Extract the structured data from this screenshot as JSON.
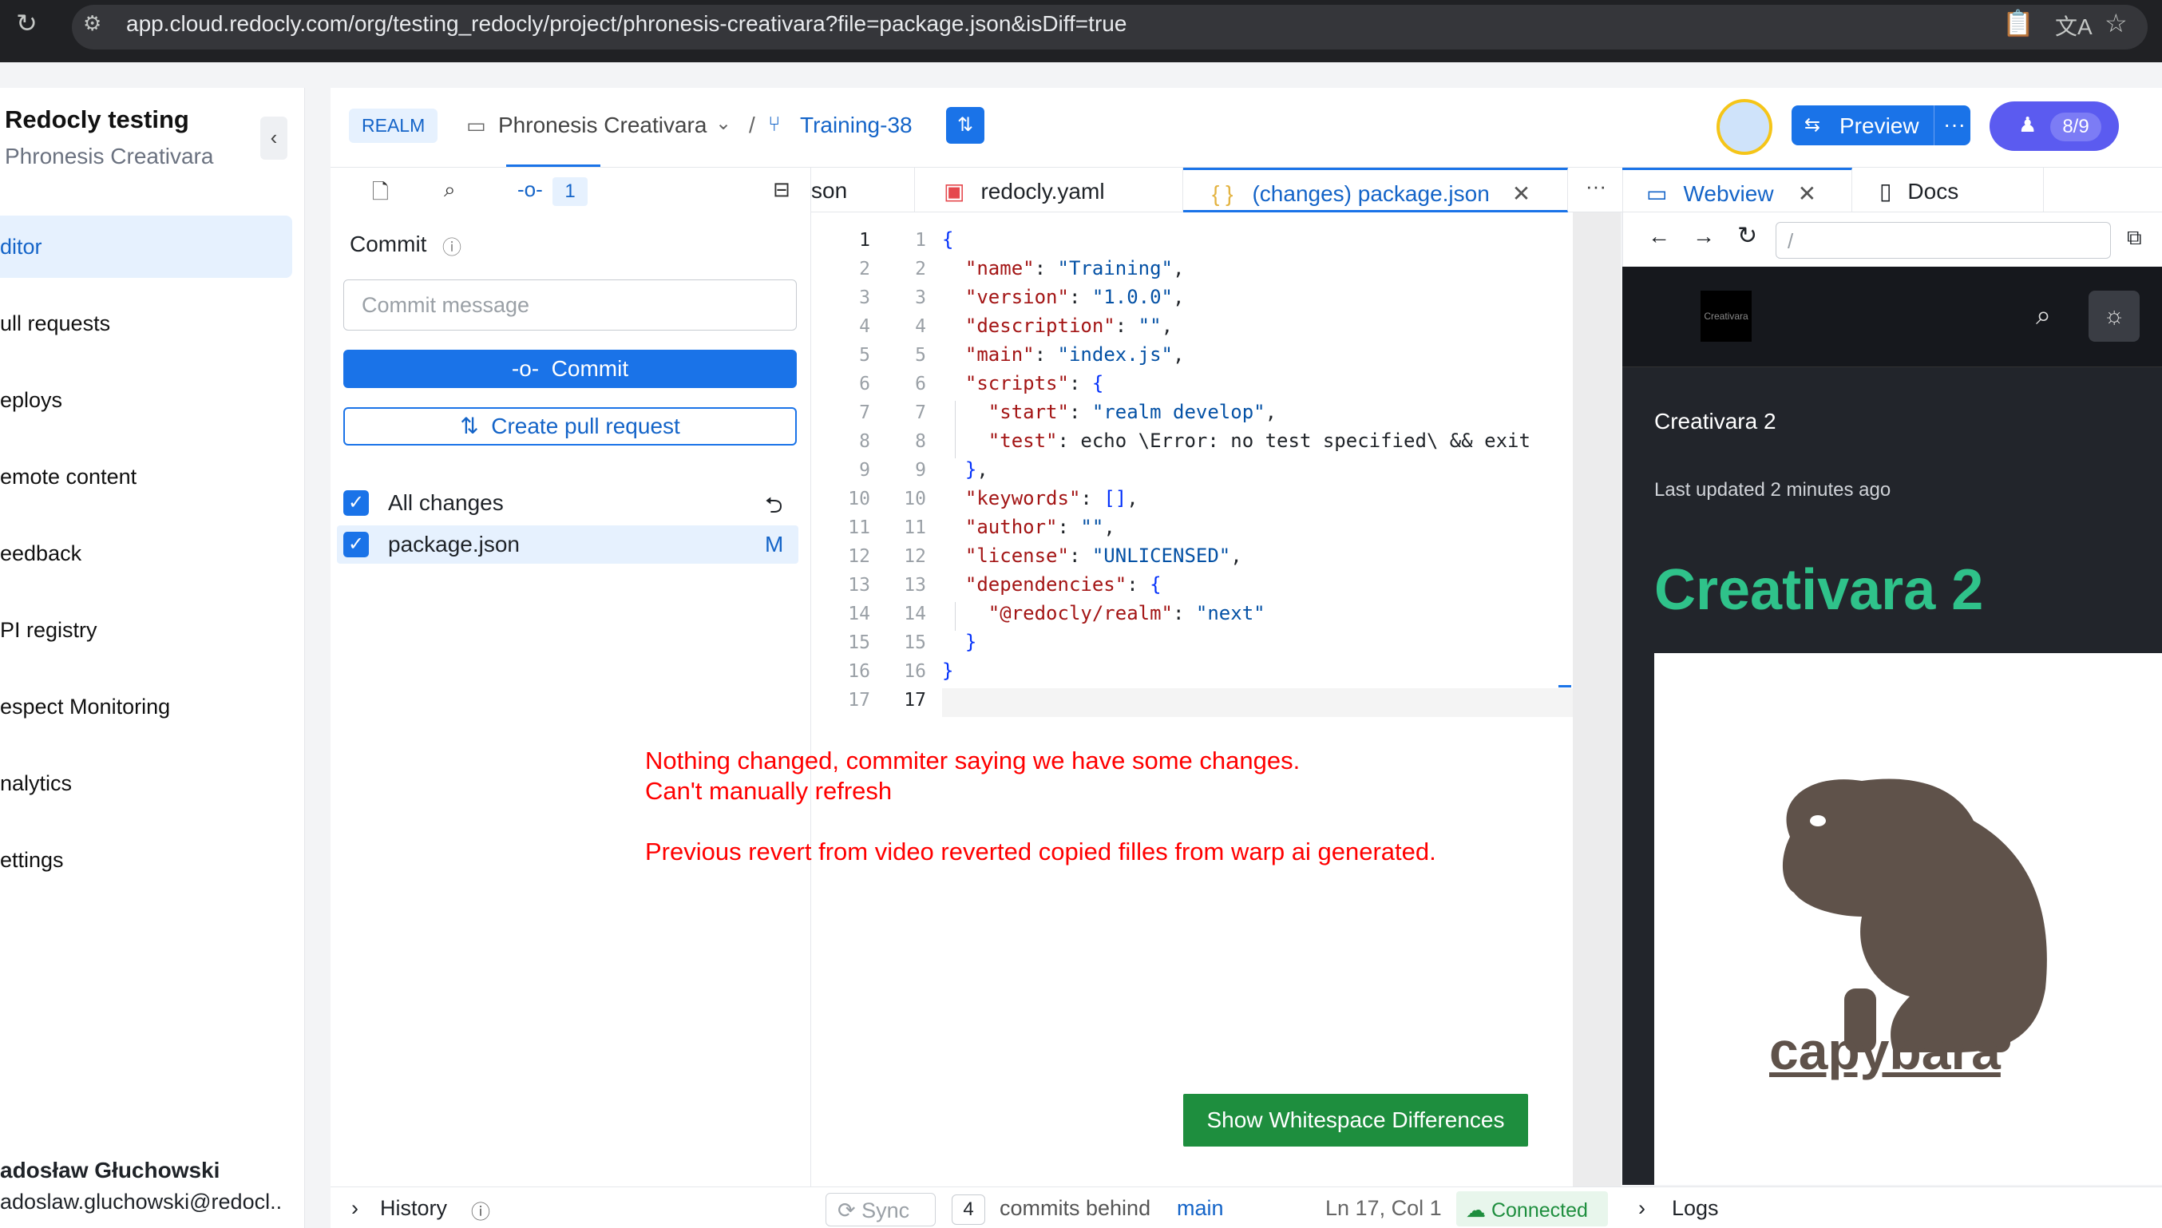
{
  "browser": {
    "url": "app.cloud.redocly.com/org/testing_redocly/project/phronesis-creativara?file=package.json&isDiff=true",
    "icons": [
      "reload-icon",
      "site-settings-icon",
      "clipboard-icon",
      "translate-icon",
      "bookmark-star-icon"
    ]
  },
  "sidebar": {
    "org_title": "Redocly testing",
    "project_name": "Phronesis Creativara",
    "items": [
      {
        "label": "ditor",
        "active": true
      },
      {
        "label": "ull requests"
      },
      {
        "label": "eploys"
      },
      {
        "label": "emote content"
      },
      {
        "label": "eedback"
      },
      {
        "label": "PI registry"
      },
      {
        "label": "espect Monitoring"
      },
      {
        "label": "nalytics"
      },
      {
        "label": "ettings"
      }
    ],
    "user_name": "adosław Głuchowski",
    "user_email": "adoslaw.gluchowski@redocl.."
  },
  "header": {
    "realm_badge": "REALM",
    "project": "Phronesis Creativara",
    "separator": "/",
    "branch": "Training-38",
    "preview_label": "Preview",
    "preview_more": "···",
    "notifications": "8/9"
  },
  "commit_panel": {
    "changes_count": "1",
    "title": "Commit",
    "message_placeholder": "Commit message",
    "commit_button": "Commit",
    "pr_button": "Create pull request",
    "all_changes_label": "All changes",
    "files": [
      {
        "name": "package.json",
        "status": "M"
      }
    ]
  },
  "editor": {
    "tabs": [
      {
        "label": "son"
      },
      {
        "label": "redocly.yaml"
      },
      {
        "label": "(changes) package.json",
        "active": true
      }
    ],
    "more_tabs": "···",
    "left_line_numbers": [
      "1",
      "2",
      "3",
      "4",
      "5",
      "6",
      "7",
      "8",
      "9",
      "10",
      "11",
      "12",
      "13",
      "14",
      "15",
      "16",
      "17"
    ],
    "right_line_numbers": [
      "1",
      "2",
      "3",
      "4",
      "5",
      "6",
      "7",
      "8",
      "9",
      "10",
      "11",
      "12",
      "13",
      "14",
      "15",
      "16",
      "17"
    ],
    "code_lines": [
      "{",
      "  \"name\": \"Training\",",
      "  \"version\": \"1.0.0\",",
      "  \"description\": \"\",",
      "  \"main\": \"index.js\",",
      "  \"scripts\": {",
      "    \"start\": \"realm develop\",",
      "    \"test\": \"echo \\\"Error: no test specified\\\" && exit",
      "  },",
      "  \"keywords\": [],",
      "  \"author\": \"\",",
      "  \"license\": \"UNLICENSED\",",
      "  \"dependencies\": {",
      "    \"@redocly/realm\": \"next\"",
      "  }",
      "}",
      ""
    ],
    "whitespace_button": "Show Whitespace Differences"
  },
  "annotation": {
    "line1": "Nothing changed, commiter saying we have some changes.",
    "line2": "Can't manually refresh",
    "line3": "Previous revert from video reverted copied filles from warp ai generated."
  },
  "preview": {
    "tabs": [
      {
        "label": "Webview",
        "active": true
      },
      {
        "label": "Docs"
      }
    ],
    "address": "/",
    "site_logo_text": "Creativara",
    "page_title_small": "Creativara 2",
    "last_updated": "Last updated 2 minutes ago",
    "heading": "Creativara 2",
    "heading_color": "#2fc28a",
    "image_caption": "capybara"
  },
  "status_bar": {
    "history_label": "History",
    "sync_label": "Sync",
    "commits_behind_count": "4",
    "commits_behind_text": "commits behind",
    "branch": "main",
    "cursor": "Ln 17, Col 1",
    "connection": "Connected",
    "logs_label": "Logs"
  }
}
